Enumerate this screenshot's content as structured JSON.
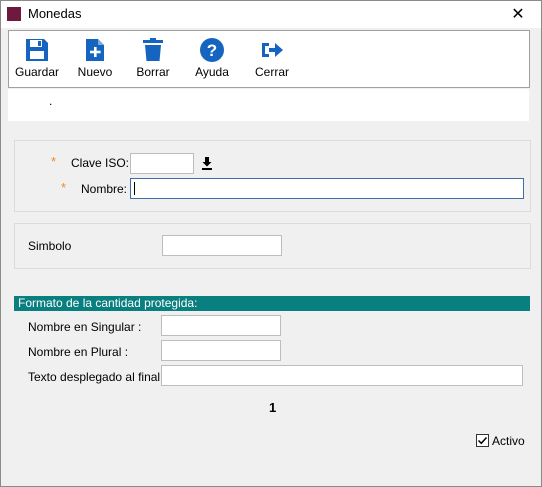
{
  "window": {
    "title": "Monedas",
    "close_glyph": "✕"
  },
  "toolbar": {
    "buttons": [
      {
        "label": "Guardar",
        "icon": "floppy-icon"
      },
      {
        "label": "Nuevo",
        "icon": "new-document-icon"
      },
      {
        "label": "Borrar",
        "icon": "trash-icon"
      },
      {
        "label": "Ayuda",
        "icon": "help-icon"
      },
      {
        "label": "Cerrar",
        "icon": "exit-icon"
      }
    ],
    "icon_color": "#1565c0"
  },
  "subbar": {
    "text": "."
  },
  "form": {
    "required_mark": "*",
    "clave_iso": {
      "label": "Clave ISO:",
      "value": ""
    },
    "nombre": {
      "label": "Nombre:",
      "value": ""
    },
    "simbolo": {
      "label": "Simbolo",
      "value": ""
    }
  },
  "formato": {
    "header": "Formato de la cantidad protegida:",
    "singular": {
      "label": "Nombre en Singular :",
      "value": ""
    },
    "plural": {
      "label": "Nombre en Plural :",
      "value": ""
    },
    "texto_final": {
      "label": "Texto desplegado al final :",
      "value": ""
    }
  },
  "page_number": "1",
  "activo": {
    "label": "Activo",
    "checked": true
  },
  "colors": {
    "section_header": "#0a7f7f",
    "required": "#f08a24",
    "app_icon": "#6d1a3e"
  }
}
